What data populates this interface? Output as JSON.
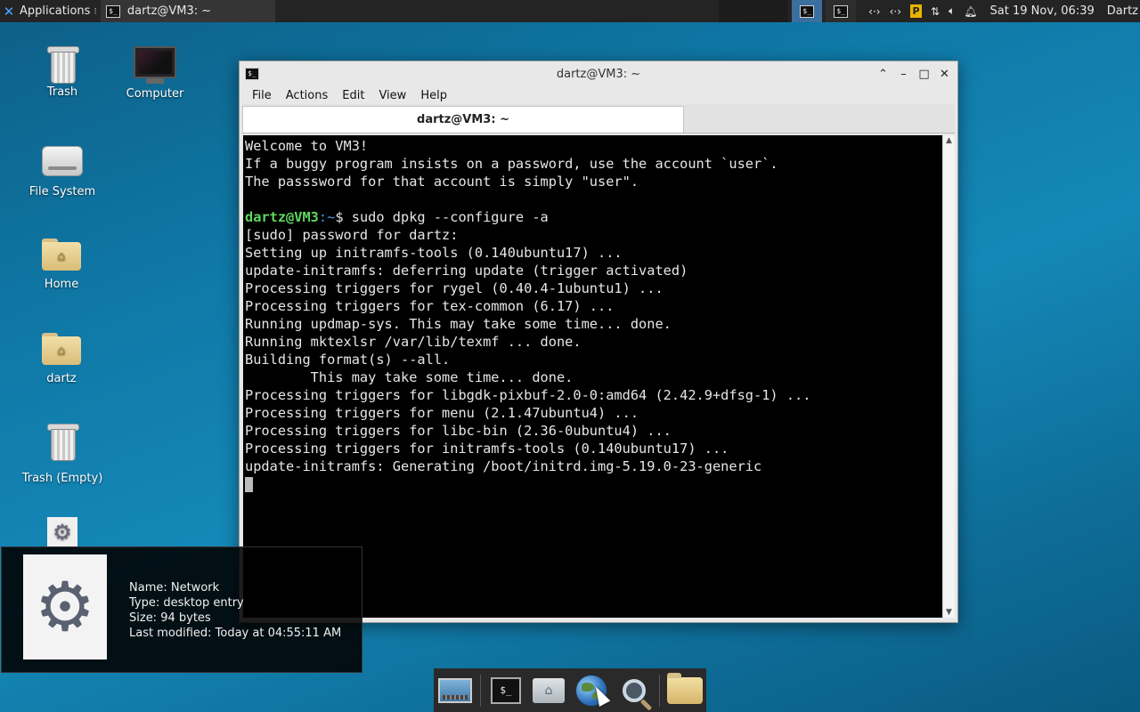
{
  "top_panel": {
    "applications_label": "Applications",
    "task_title": "dartz@VM3: ~",
    "clock": "Sat 19 Nov, 06:39",
    "user": "Dartz",
    "tray_badge": "P"
  },
  "desktop_icons": [
    {
      "label": "Trash",
      "icon": "trash-icon"
    },
    {
      "label": "Computer",
      "icon": "computer-icon"
    },
    {
      "label": "File System",
      "icon": "drive-icon"
    },
    {
      "label": "Home",
      "icon": "home-folder-icon"
    },
    {
      "label": "dartz",
      "icon": "home-folder-icon"
    },
    {
      "label": "Trash (Empty)",
      "icon": "trash-icon"
    }
  ],
  "terminal": {
    "window_title": "dartz@VM3: ~",
    "tab_title": "dartz@VM3: ~",
    "menu": [
      "File",
      "Actions",
      "Edit",
      "View",
      "Help"
    ],
    "prompt_user": "dartz@VM3",
    "prompt_path": ":~",
    "prompt_symbol": "$ ",
    "command": "sudo dpkg --configure -a",
    "welcome_lines": "Welcome to VM3!\nIf a buggy program insists on a password, use the account `user`.\nThe passsword for that account is simply \"user\".\n\n",
    "output_lines": "\n[sudo] password for dartz:\nSetting up initramfs-tools (0.140ubuntu17) ...\nupdate-initramfs: deferring update (trigger activated)\nProcessing triggers for rygel (0.40.4-1ubuntu1) ...\nProcessing triggers for tex-common (6.17) ...\nRunning updmap-sys. This may take some time... done.\nRunning mktexlsr /var/lib/texmf ... done.\nBuilding format(s) --all.\n        This may take some time... done.\nProcessing triggers for libgdk-pixbuf-2.0-0:amd64 (2.42.9+dfsg-1) ...\nProcessing triggers for menu (2.1.47ubuntu4) ...\nProcessing triggers for libc-bin (2.36-0ubuntu4) ...\nProcessing triggers for initramfs-tools (0.140ubuntu17) ...\nupdate-initramfs: Generating /boot/initrd.img-5.19.0-23-generic\n"
  },
  "tooltip": {
    "name": "Name: Network",
    "type": "Type: desktop entry",
    "size": "Size: 94 bytes",
    "modified": "Last modified: Today at 04:55:11 AM"
  },
  "dock": [
    "show-desktop-icon",
    "terminal-icon",
    "home-icon",
    "web-browser-icon",
    "search-icon",
    "folder-icon"
  ]
}
